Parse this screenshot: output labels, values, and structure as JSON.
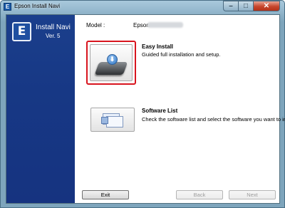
{
  "window": {
    "title": "Epson Install Navi",
    "app_icon_glyph": "E",
    "controls": {
      "minimize_glyph": "–",
      "maximize_glyph": "□",
      "close_glyph": "✕"
    }
  },
  "sidebar": {
    "logo_glyph": "E",
    "title": "Install Navi",
    "version": "Ver. 5"
  },
  "model": {
    "label": "Model :",
    "brand": "Epson"
  },
  "options": {
    "easy_install": {
      "title": "Easy Install",
      "description": "Guided full installation and setup.",
      "icon_glyph": "⬇"
    },
    "software_list": {
      "title": "Software List",
      "description": "Check the software list and select the software you want to install."
    }
  },
  "buttons": {
    "exit": "Exit",
    "back": "Back",
    "next": "Next"
  },
  "colors": {
    "sidebar": "#173885",
    "selection_highlight": "#d8141e"
  }
}
